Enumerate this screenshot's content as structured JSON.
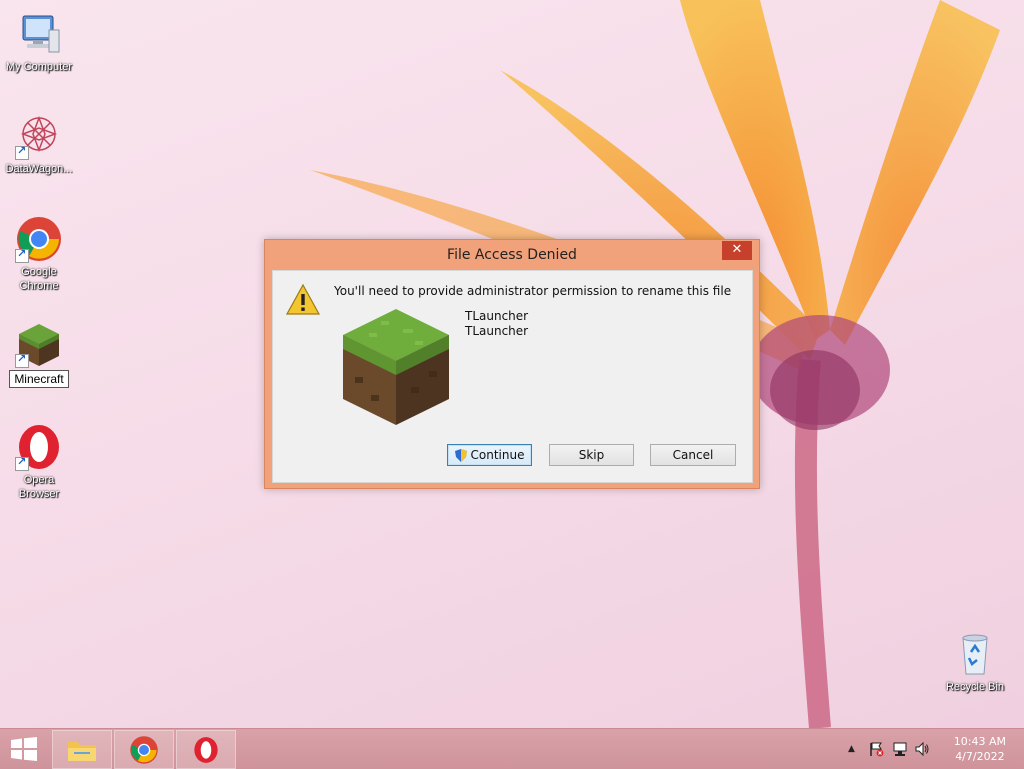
{
  "desktop": {
    "icons": [
      {
        "label": "My Computer"
      },
      {
        "label": "DataWagon..."
      },
      {
        "label": "Google Chrome"
      },
      {
        "label": "Minecraft"
      },
      {
        "label": "Opera Browser"
      },
      {
        "label": "Recycle Bin"
      }
    ]
  },
  "dialog": {
    "title": "File Access Denied",
    "close_label": "✕",
    "message": "You'll need to provide administrator permission to rename this file",
    "file_name": "TLauncher",
    "file_type": "TLauncher",
    "buttons": {
      "continue": "Continue",
      "skip": "Skip",
      "cancel": "Cancel"
    }
  },
  "taskbar": {
    "pinned": [
      "file-explorer",
      "google-chrome",
      "opera-browser"
    ],
    "clock": {
      "time": "10:43 AM",
      "date": "4/7/2022"
    }
  },
  "colors": {
    "dialog_frame": "#f2a27a",
    "close_button": "#c7402c",
    "taskbar": "#d39aa1"
  }
}
